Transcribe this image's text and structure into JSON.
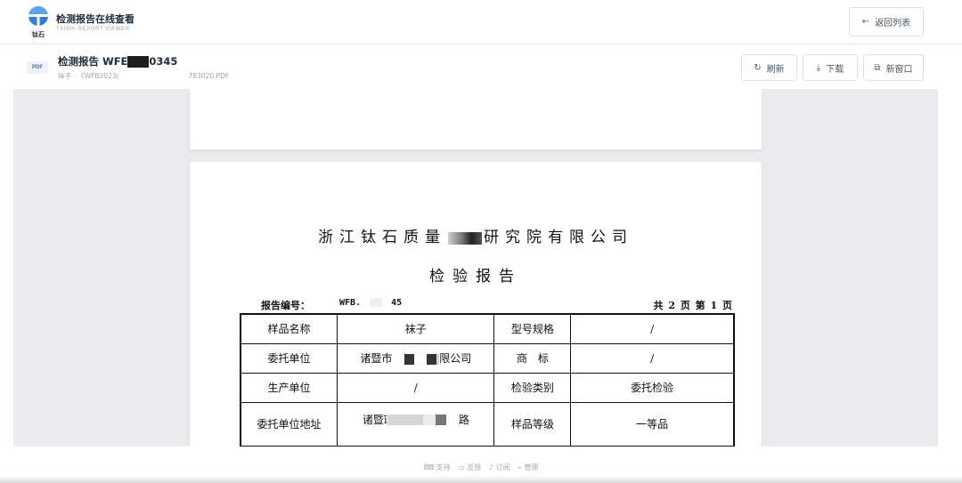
{
  "header": {
    "logo_text": "钛石",
    "title": "检测报告在线查看",
    "subtitle": "TAISHI REPORT VIEWER",
    "back_label": "返回列表"
  },
  "file": {
    "badge": "PDF",
    "title_prefix": "检测报告 WFE",
    "title_suffix": "0345",
    "meta_left": "袜子 · 《WFB2023(",
    "meta_right": "783020.PDF"
  },
  "toolbar": {
    "refresh_label": "刷新",
    "download_label": "下载",
    "newwin_label": "新窗口"
  },
  "document": {
    "company_left": "浙江钛石质量",
    "company_right": "研究院有限公司",
    "title": "检验报告",
    "report_no_label": "报告编号：",
    "report_no_prefix": "WFB.",
    "report_no_suffix": "45",
    "page_info": "共 2 页 第 1 页",
    "table": {
      "r1": [
        "样品名称",
        "袜子",
        "型号规格",
        "/"
      ],
      "r2": [
        "委托单位",
        "诸暨市",
        "限公司",
        "商　标",
        "/"
      ],
      "r3": [
        "生产单位",
        "/",
        "检验类别",
        "委托检验"
      ],
      "r4": [
        "委托单位地址",
        "诸暨ī",
        "路",
        "样品等级",
        "一等品"
      ]
    }
  },
  "footer": {
    "items": [
      "支持",
      "反馈",
      "订阅",
      "管理"
    ]
  }
}
